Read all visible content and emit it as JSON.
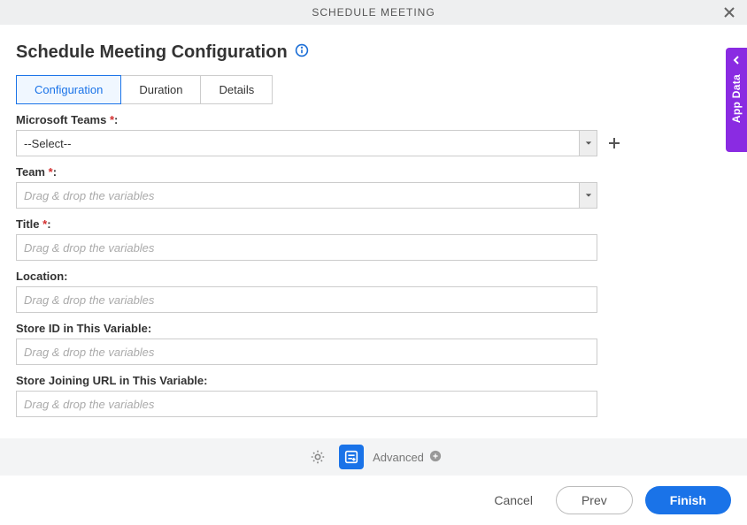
{
  "modal": {
    "title": "SCHEDULE MEETING"
  },
  "page": {
    "heading": "Schedule Meeting Configuration"
  },
  "tabs": {
    "configuration": "Configuration",
    "duration": "Duration",
    "details": "Details"
  },
  "fields": {
    "teams_app": {
      "label": "Microsoft Teams",
      "value": "--Select--"
    },
    "team": {
      "label": "Team",
      "placeholder": "Drag & drop the variables"
    },
    "title": {
      "label": "Title",
      "placeholder": "Drag & drop the variables"
    },
    "location": {
      "label": "Location:",
      "placeholder": "Drag & drop the variables"
    },
    "store_id": {
      "label": "Store ID in This Variable:",
      "placeholder": "Drag & drop the variables"
    },
    "store_url": {
      "label": "Store Joining URL in This Variable:",
      "placeholder": "Drag & drop the variables"
    }
  },
  "side_panel": {
    "label": "App Data"
  },
  "toolbar": {
    "advanced": "Advanced"
  },
  "footer": {
    "cancel": "Cancel",
    "prev": "Prev",
    "finish": "Finish"
  }
}
